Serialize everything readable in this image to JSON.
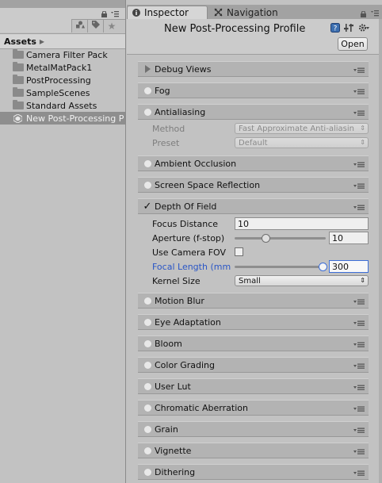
{
  "project": {
    "breadcrumb": "Assets",
    "items": [
      {
        "label": "Camera Filter Pack",
        "type": "folder"
      },
      {
        "label": "MetalMatPack1",
        "type": "folder"
      },
      {
        "label": "PostProcessing",
        "type": "folder"
      },
      {
        "label": "SampleScenes",
        "type": "folder"
      },
      {
        "label": "Standard Assets",
        "type": "folder"
      },
      {
        "label": "New Post-Processing P",
        "type": "asset",
        "selected": true
      }
    ]
  },
  "tabs": {
    "inspector": "Inspector",
    "navigation": "Navigation"
  },
  "inspector": {
    "title": "New Post-Processing Profile",
    "open_label": "Open"
  },
  "effects": {
    "debug_views": "Debug Views",
    "fog": "Fog",
    "antialiasing": "Antialiasing",
    "ambient_occlusion": "Ambient Occlusion",
    "ssr": "Screen Space Reflection",
    "dof": "Depth Of Field",
    "motion_blur": "Motion Blur",
    "eye_adaptation": "Eye Adaptation",
    "bloom": "Bloom",
    "color_grading": "Color Grading",
    "user_lut": "User Lut",
    "chromatic_aberration": "Chromatic Aberration",
    "grain": "Grain",
    "vignette": "Vignette",
    "dithering": "Dithering"
  },
  "antialiasing": {
    "method_label": "Method",
    "method_value": "Fast Approximate Anti-aliasin",
    "preset_label": "Preset",
    "preset_value": "Default"
  },
  "dof": {
    "focus_distance_label": "Focus Distance",
    "focus_distance_value": "10",
    "aperture_label": "Aperture (f-stop)",
    "aperture_value": "10",
    "aperture_slider_fraction": 0.32,
    "use_camera_fov_label": "Use Camera FOV",
    "use_camera_fov_checked": false,
    "focal_length_label": "Focal Length (mm",
    "focal_length_value": "300",
    "focal_length_slider_fraction": 1.0,
    "kernel_size_label": "Kernel Size",
    "kernel_size_value": "Small"
  },
  "colors": {
    "focused_label": "#2a56c6",
    "panel_bg": "#c2c2c2",
    "effect_header_bg": "#b3b3b3"
  }
}
